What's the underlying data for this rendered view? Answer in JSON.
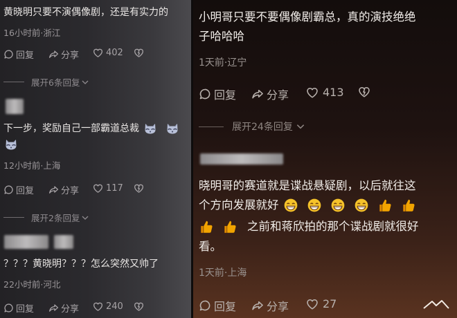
{
  "left": {
    "c1": {
      "text": "黄晓明只要不演偶像剧，还是有实力的",
      "meta": "16小时前·浙江",
      "reply": "回复",
      "share": "分享",
      "likes": "402"
    },
    "expand1": "展开6条回复",
    "c2": {
      "text1": "下一步，奖励自己一部霸道总裁",
      "meta": "12小时前·上海",
      "reply": "回复",
      "share": "分享",
      "likes": "117"
    },
    "expand2": "展开2条回复",
    "c3": {
      "text": "？？？黄晓明？？？怎么突然又帅了",
      "meta": "22小时前·河北",
      "reply": "回复",
      "share": "分享",
      "likes": "240"
    }
  },
  "right": {
    "c1": {
      "line1": "小明哥只要不要偶像剧霸总，真的演技绝绝",
      "line2": "子哈哈哈",
      "meta": "1天前·辽宁",
      "reply": "回复",
      "share": "分享",
      "likes": "413"
    },
    "expand": "展开24条回复",
    "c2": {
      "line1": "晓明哥的赛道就是谍战悬疑剧，以后就往这",
      "line2": "个方向发展就好",
      "line3": "之前和蒋欣拍的那个谍战剧就很好",
      "line4": "看。",
      "meta": "1天前·上海",
      "reply": "回复",
      "share": "分享",
      "likes": "27"
    }
  },
  "colors": {
    "left_bg": "#2b2a2e",
    "right_bg": "#1e1210",
    "thumb": "#f2a400",
    "grin": "#f5c22a"
  },
  "icons": [
    "reply-icon",
    "share-icon",
    "like-icon",
    "dislike-icon",
    "chevron-down-icon",
    "cat-face-emoji",
    "grin-emoji",
    "thumbs-up-emoji"
  ]
}
